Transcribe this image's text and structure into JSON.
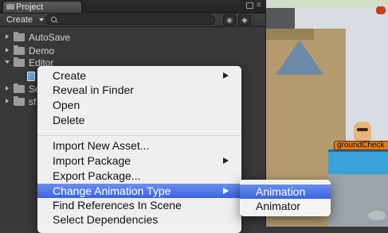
{
  "panel": {
    "tab_title": "Project",
    "create_label": "Create",
    "search_placeholder": ""
  },
  "tree": [
    {
      "label": "AutoSave",
      "expanded": false,
      "type": "folder"
    },
    {
      "label": "Demo",
      "expanded": false,
      "type": "folder"
    },
    {
      "label": "Editor",
      "expanded": true,
      "type": "folder"
    },
    {
      "label": "",
      "expanded": false,
      "type": "script"
    },
    {
      "label": "So",
      "expanded": false,
      "type": "folder"
    },
    {
      "label": "sf",
      "expanded": false,
      "type": "folder"
    }
  ],
  "scene": {
    "object_label": "groundCheck"
  },
  "context_menu": {
    "items": [
      {
        "label": "Create",
        "submenu": true
      },
      {
        "label": "Reveal in Finder",
        "submenu": false
      },
      {
        "label": "Open",
        "submenu": false
      },
      {
        "label": "Delete",
        "submenu": false
      },
      {
        "label": "Import New Asset...",
        "submenu": false
      },
      {
        "label": "Import Package",
        "submenu": true
      },
      {
        "label": "Export Package...",
        "submenu": false
      },
      {
        "label": "Change Animation Type",
        "submenu": true,
        "highlighted": true
      },
      {
        "label": "Find References In Scene",
        "submenu": false
      },
      {
        "label": "Select Dependencies",
        "submenu": false
      }
    ]
  },
  "submenu": {
    "items": [
      {
        "label": "Animation",
        "highlighted": true
      },
      {
        "label": "Animator",
        "highlighted": false
      }
    ]
  },
  "colors": {
    "highlight": "#3a64de",
    "panel_bg": "#383838",
    "menu_bg": "#f6f6f6"
  }
}
